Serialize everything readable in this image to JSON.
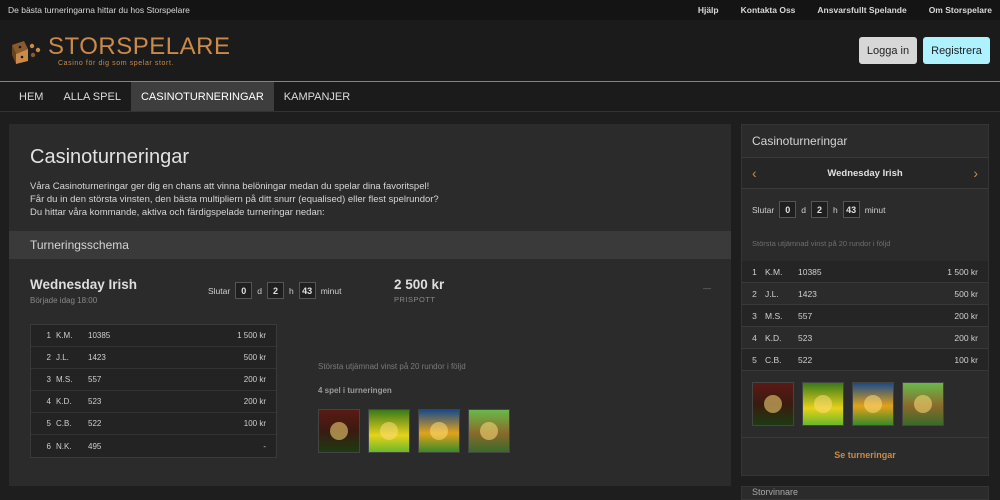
{
  "topbar": {
    "tagline": "De bästa turneringarna hittar du hos Storspelare",
    "links": [
      "Hjälp",
      "Kontakta Oss",
      "Ansvarsfullt Spelande",
      "Om Storspelare"
    ]
  },
  "header": {
    "logo_name": "STORSPELARE",
    "logo_tag": "Casino för dig som spelar stort.",
    "login_label": "Logga in",
    "register_label": "Registrera"
  },
  "nav": {
    "items": [
      "HEM",
      "ALLA SPEL",
      "CASINOTURNERINGAR",
      "KAMPANJER"
    ],
    "active": "CASINOTURNERINGAR"
  },
  "main": {
    "title": "Casinoturneringar",
    "intro": [
      "Våra Casinoturneringar ger dig en chans att vinna belöningar medan du spelar dina favoritspel!",
      "Får du in den största vinsten, den bästa multipliern på ditt snurr (equalised) eller flest spelrundor?",
      "Du hittar våra kommande, aktiva och färdigspelade turneringar nedan:"
    ],
    "schema_title": "Turneringsschema",
    "tournament": {
      "name": "Wednesday Irish",
      "started": "Började idag 18:00",
      "ends_label": "Slutar",
      "days": "0",
      "days_unit": "d",
      "hours": "2",
      "hours_unit": "h",
      "minutes": "43",
      "minutes_unit": "minut",
      "prize": "2 500 kr",
      "prize_label": "PRISPOTT",
      "dash": "—",
      "description": "Största utjämnad vinst på 20 rundor i följd",
      "games_count": "4 spel i turneringen",
      "leaderboard": [
        {
          "rank": "1",
          "name": "K.M.",
          "score": "10385",
          "prize": "1 500 kr"
        },
        {
          "rank": "2",
          "name": "J.L.",
          "score": "1423",
          "prize": "500 kr"
        },
        {
          "rank": "3",
          "name": "M.S.",
          "score": "557",
          "prize": "200 kr"
        },
        {
          "rank": "4",
          "name": "K.D.",
          "score": "523",
          "prize": "200 kr"
        },
        {
          "rank": "5",
          "name": "C.B.",
          "score": "522",
          "prize": "100 kr"
        },
        {
          "rank": "6",
          "name": "N.K.",
          "score": "495",
          "prize": "-"
        }
      ]
    }
  },
  "side": {
    "title": "Casinoturneringar",
    "name": "Wednesday Irish",
    "prev_arrow": "‹",
    "next_arrow": "›",
    "ends_label": "Slutar",
    "days": "0",
    "days_unit": "d",
    "hours": "2",
    "hours_unit": "h",
    "minutes": "43",
    "minutes_unit": "minut",
    "description": "Största utjämnad vinst på 20 rundor i följd",
    "leaderboard": [
      {
        "rank": "1",
        "name": "K.M.",
        "score": "10385",
        "prize": "1 500 kr"
      },
      {
        "rank": "2",
        "name": "J.L.",
        "score": "1423",
        "prize": "500 kr"
      },
      {
        "rank": "3",
        "name": "M.S.",
        "score": "557",
        "prize": "200 kr"
      },
      {
        "rank": "4",
        "name": "K.D.",
        "score": "523",
        "prize": "200 kr"
      },
      {
        "rank": "5",
        "name": "C.B.",
        "score": "522",
        "prize": "100 kr"
      }
    ],
    "link_label": "Se turneringar",
    "next_title": "Storvinnare"
  },
  "colors": {
    "accent": "#c98a4a",
    "register": "#aef1ff",
    "background": "#1e1e1e",
    "panel": "#2b2b2b"
  }
}
